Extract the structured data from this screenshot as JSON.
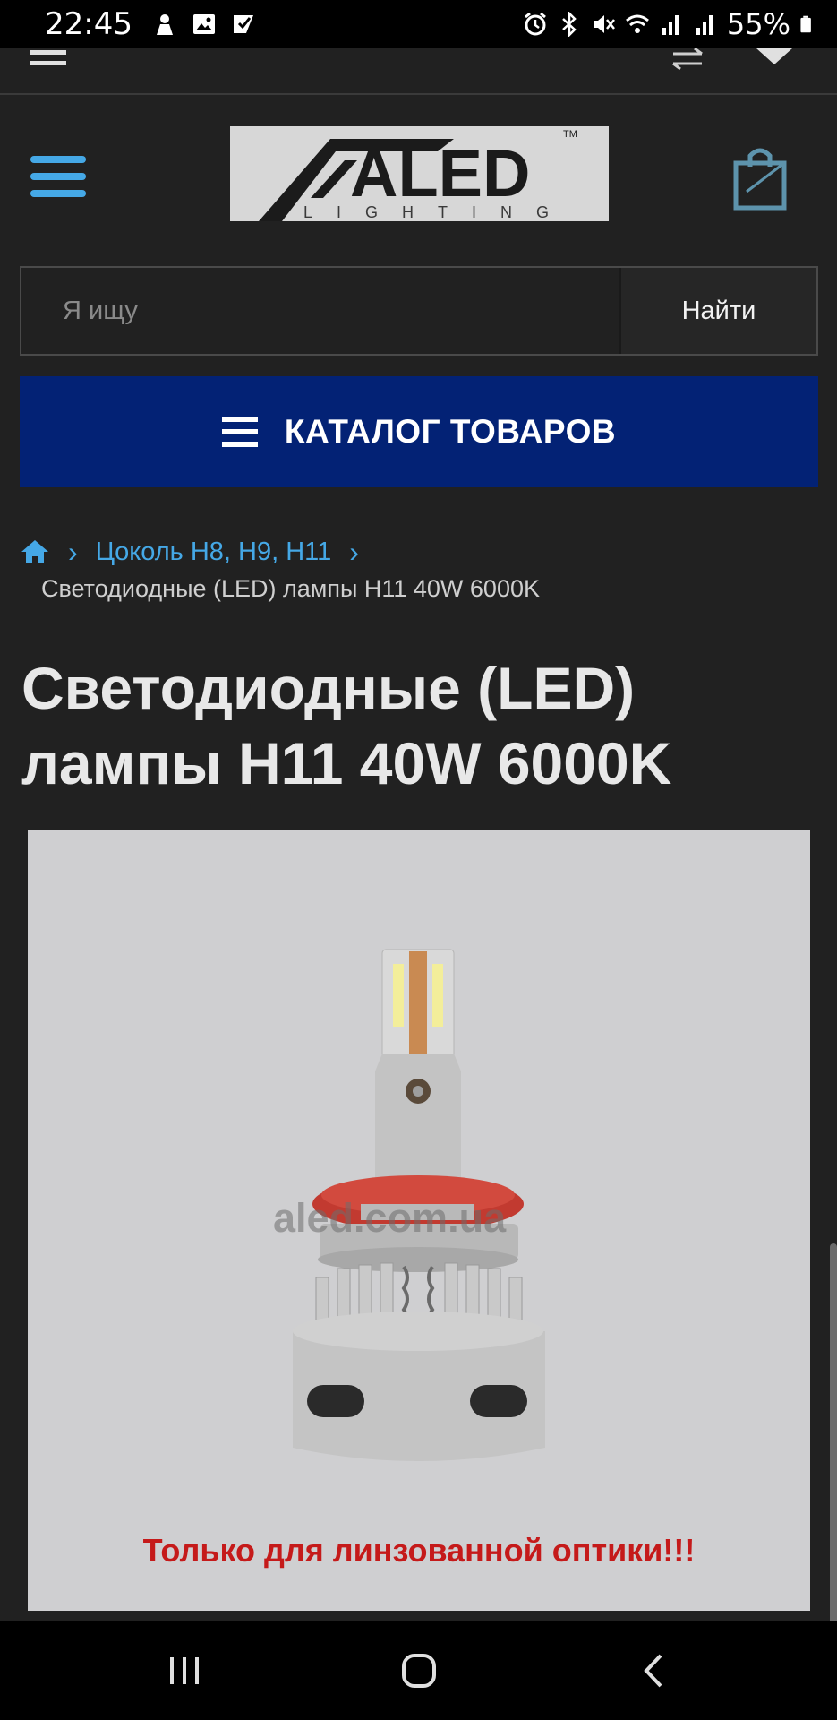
{
  "status_bar": {
    "time": "22:45",
    "battery_percent": "55%",
    "icons_left": [
      "download-app-icon",
      "image-icon",
      "checkbox-icon"
    ],
    "icons_right": [
      "alarm-icon",
      "bluetooth-icon",
      "mute-icon",
      "wifi-icon",
      "signal-icon",
      "signal-icon",
      "battery-icon"
    ]
  },
  "header": {
    "logo_text": "ALED",
    "logo_sub": "LIGHTING",
    "logo_tm": "TM"
  },
  "search": {
    "placeholder": "Я ищу",
    "button_label": "Найти"
  },
  "catalog": {
    "label": "КАТАЛОГ ТОВАРОВ"
  },
  "breadcrumb": {
    "home_icon": "home-icon",
    "separator": "›",
    "link_label": "Цоколь H8, H9, H11",
    "current": "Светодиодные (LED) лампы H11 40W 6000K"
  },
  "page": {
    "title": "Светодиодные (LED) лампы H11 40W 6000K"
  },
  "product_image": {
    "watermark": "aled.com.ua",
    "warning_text": "Только для линзованной оптики!!!"
  },
  "colors": {
    "accent": "#45a8e6",
    "catalog_bg": "#032275",
    "background": "#212121",
    "warning": "#c51a1a"
  }
}
